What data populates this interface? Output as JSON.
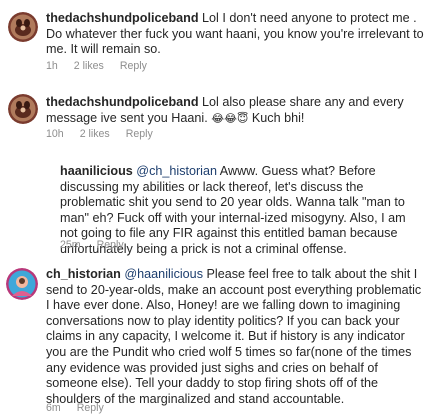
{
  "comments": [
    {
      "username": "thedachshundpoliceband",
      "text": " Lol I don't need anyone to protect me . Do whatever ther fuck you want haani, you know you're irrelevant to me. It will remain so.",
      "time": "1h",
      "likes": "2 likes",
      "reply": "Reply"
    },
    {
      "username": "thedachshundpoliceband",
      "text": " Lol also please share any and every message ive sent you Haani. ",
      "emojis": "😂😂😇",
      "text_after": " Kuch bhi!",
      "time": "10h",
      "likes": "2 likes",
      "reply": "Reply"
    },
    {
      "username": "haanilicious",
      "mention": "@ch_historian",
      "text": " Awww. Guess what? Before discussing my abilities or lack thereof, let's discuss the problematic shit you send to 20 year olds. Wanna talk \"man to man\" eh? Fuck off with your internal-ized misogyny. Also, I am not going to file any FIR against this entitled baman because unfortunately being a prick is not a criminal offense.",
      "time": "25m",
      "reply": "Reply"
    },
    {
      "username": "ch_historian",
      "mention": "@haanilicious",
      "text": " Please feel free to talk about the shit I send to 20-year-olds, make an account post everything problematic I have ever done. Also, Honey! are we falling down to imagining conversations now to play identity politics? If you can back your claims in any capacity, I welcome it. But if history is any indicator you are the Pundit who cried wolf 5 times so far(none of the times any evidence was provided just sighs and cries on behalf of someone else). Tell your daddy to stop firing shots off of the shoulders of the marginalized and stand accountable.",
      "time": "6m",
      "reply": "Reply"
    }
  ]
}
